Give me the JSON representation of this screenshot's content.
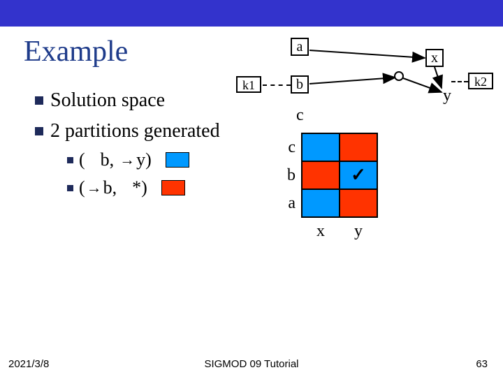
{
  "title": "Example",
  "bullets": {
    "b1": "Solution space",
    "b2": "2 partitions generated",
    "p1_open": "(",
    "p1_a": "b,",
    "p1_b": "y)",
    "p2_open": "(",
    "p2_a": "b,",
    "p2_b": "*)"
  },
  "neg": "¬",
  "arrow": "→",
  "graph": {
    "a": "a",
    "b": "b",
    "c": "c",
    "x": "x",
    "y": "y",
    "k1": "k1",
    "k2": "k2"
  },
  "grid": {
    "rows": [
      "c",
      "b",
      "a"
    ],
    "cols": [
      "x",
      "y"
    ],
    "check": "✓"
  },
  "footer": {
    "date": "2021/3/8",
    "center": "SIGMOD 09 Tutorial",
    "page": "63"
  }
}
